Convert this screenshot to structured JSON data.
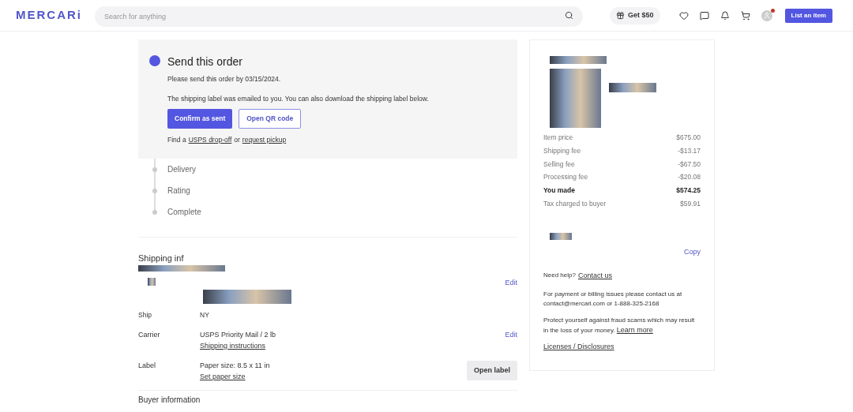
{
  "header": {
    "logo": "MERCARi",
    "search": {
      "placeholder": "Search for anything"
    },
    "promo": "Get $50",
    "notification_dot": true,
    "cta": "List an item"
  },
  "progress": {
    "steps": [
      {
        "label": "Send this order",
        "selected": true,
        "lines": [
          "Please send this order by 03/15/2024.",
          "The shipping label was emailed to you. You can also download the shipping label below."
        ],
        "buttons": [
          {
            "label": "Confirm as sent",
            "kind": "primary"
          },
          {
            "label": "Open QR code",
            "kind": "outline"
          }
        ],
        "help": {
          "prefix": "Find a",
          "link1": "USPS drop-off",
          "middle": "or",
          "link2": "request pickup"
        }
      },
      {
        "label": "Delivery",
        "selected": false
      },
      {
        "label": "Rating",
        "selected": false
      },
      {
        "label": "Complete",
        "selected": false
      }
    ]
  },
  "shipping": {
    "title": "Shipping inf",
    "address_edit": "Edit",
    "ship_from": {
      "label": "Ship",
      "value": "NY"
    },
    "rows": [
      {
        "label": "Carrier",
        "value": "USPS Priority Mail / 2 lb",
        "link": "Shipping instructions",
        "action": "Edit",
        "kind": "link"
      },
      {
        "label": "Label",
        "value": "Paper size: 8.5 x 11 in",
        "link": "Set paper size",
        "action": "Open label",
        "kind": "button"
      }
    ]
  },
  "buyer": {
    "title": "Buyer information"
  },
  "summary": {
    "fees": [
      {
        "label": "Item price",
        "value": "$675.00",
        "bold": false
      },
      {
        "label": "Shipping fee",
        "value": "-$13.17",
        "bold": false
      },
      {
        "label": "Selling fee",
        "value": "-$67.50",
        "bold": false
      },
      {
        "label": "Processing fee",
        "value": "-$20.08",
        "bold": false
      },
      {
        "label": "You made",
        "value": "$574.25",
        "bold": true
      },
      {
        "label": "Tax charged to buyer",
        "value": "$59.91",
        "bold": false
      }
    ],
    "copy": "Copy",
    "help": {
      "prefix": "Need help?",
      "link": "Contact us"
    },
    "billing": "For payment or billing issues please contact us at contact@mercari.com or 1-888-325-2168",
    "fraud": "Protect yourself against fraud scams which may result in the loss of your money.",
    "fraud_link": "Learn more",
    "licenses": "Licenses / Disclosures"
  }
}
